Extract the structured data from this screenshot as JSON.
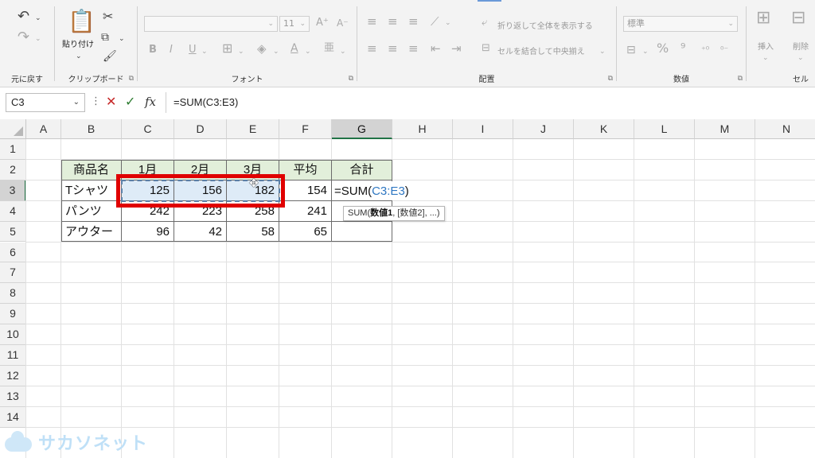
{
  "ribbon": {
    "undo": {
      "label": "元に戻す"
    },
    "clipboard": {
      "label": "クリップボード",
      "paste_label": "貼り付け"
    },
    "font": {
      "label": "フォント",
      "font_name": "",
      "font_size": "11"
    },
    "alignment": {
      "label": "配置",
      "wrap_text": "折り返して全体を表示する",
      "merge_center": "セルを結合して中央揃え"
    },
    "number": {
      "label": "数値",
      "format": "標準"
    },
    "cells": {
      "label": "セル",
      "insert": "挿入",
      "delete": "削除"
    }
  },
  "formula_bar": {
    "name_box": "C3",
    "fx": "fx",
    "formula": "=SUM(C3:E3)"
  },
  "grid": {
    "columns": [
      "A",
      "B",
      "C",
      "D",
      "E",
      "F",
      "G",
      "H",
      "I",
      "J",
      "K",
      "L",
      "M",
      "N"
    ],
    "rows": [
      "1",
      "2",
      "3",
      "4",
      "5",
      "6",
      "7",
      "8",
      "9",
      "10",
      "11",
      "12",
      "13",
      "14"
    ],
    "selected_column": "G",
    "selected_row": "3",
    "table": {
      "headers": [
        "商品名",
        "1月",
        "2月",
        "3月",
        "平均",
        "合計"
      ],
      "rows": [
        {
          "name": "Tシャツ",
          "jan": "125",
          "feb": "156",
          "mar": "182",
          "avg": "154"
        },
        {
          "name": "パンツ",
          "jan": "242",
          "feb": "223",
          "mar": "258",
          "avg": "241"
        },
        {
          "name": "アウター",
          "jan": "96",
          "feb": "42",
          "mar": "58",
          "avg": "65"
        }
      ]
    },
    "edit": {
      "prefix": "=SUM(",
      "ref": "C3:E3",
      "suffix": ")"
    },
    "tooltip": {
      "func": "SUM(",
      "arg1": "数値1",
      "rest": ", [数値2], ...)"
    }
  },
  "watermark": {
    "text": "サカソネット"
  },
  "colors": {
    "accent_green": "#217346",
    "highlight_red": "#e00000",
    "header_fill": "#e2efda",
    "ref_blue": "#2f77c2"
  }
}
